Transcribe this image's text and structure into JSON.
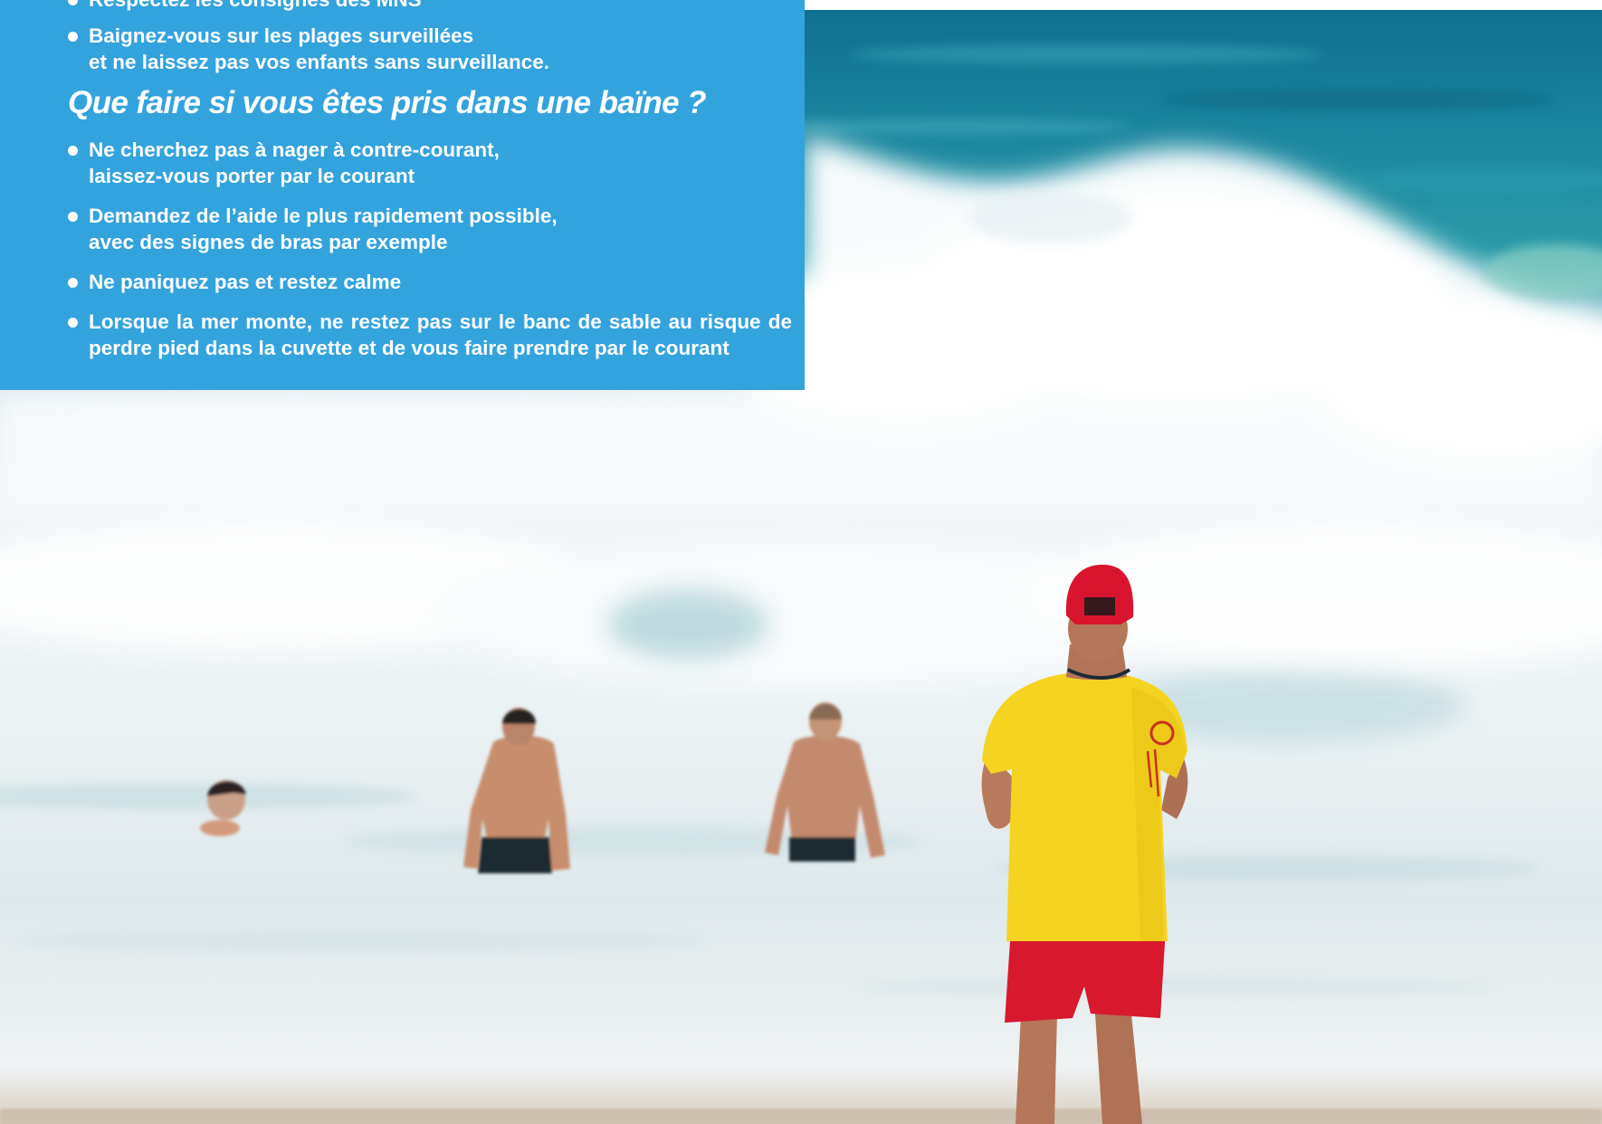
{
  "info_box": {
    "background_color": "#33a3de",
    "text_color": "#ffffff",
    "top_items": [
      "Respectez les consignes des MNS",
      "Baignez-vous sur les plages surveillées\net ne laissez pas vos enfants sans surveillance."
    ],
    "heading": "Que faire si vous êtes pris dans une baïne ?",
    "bottom_items": [
      "Ne cherchez pas à nager à contre-courant,\nlaissez-vous porter par le courant",
      "Demandez de l’aide le plus rapidement possible,\navec des signes de bras par exemple",
      "Ne paniquez pas et restez calme",
      "Lorsque la mer monte, ne restez pas sur le banc de sable au risque de perdre pied dans la cuvette et de vous faire prendre par le courant"
    ]
  },
  "photo": {
    "subject": "lifeguard-watching-swimmers-in-surf",
    "colors": {
      "deep_sea": "#0f6f8e",
      "foam": "#f4f8fa",
      "shirt": "#f5d321",
      "shorts": "#d8182c",
      "cap": "#d8142f"
    }
  }
}
